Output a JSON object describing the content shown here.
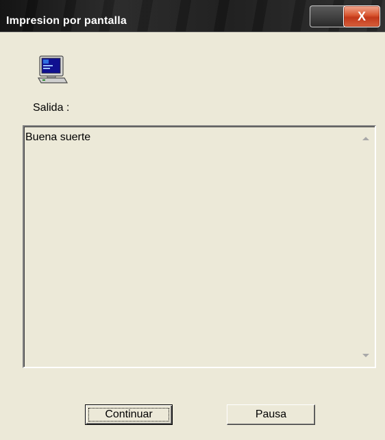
{
  "window": {
    "title": "Impresion por pantalla",
    "close_label": "X"
  },
  "icon": {
    "name": "computer-icon"
  },
  "output": {
    "label": "Salida :",
    "text": "Buena suerte"
  },
  "buttons": {
    "continue_label": "Continuar",
    "pause_label": "Pausa"
  },
  "colors": {
    "dialog_background": "#ece9d8",
    "titlebar": "#1a1a1a",
    "title_text": "#ffffff",
    "close_button": "#d8552f"
  }
}
